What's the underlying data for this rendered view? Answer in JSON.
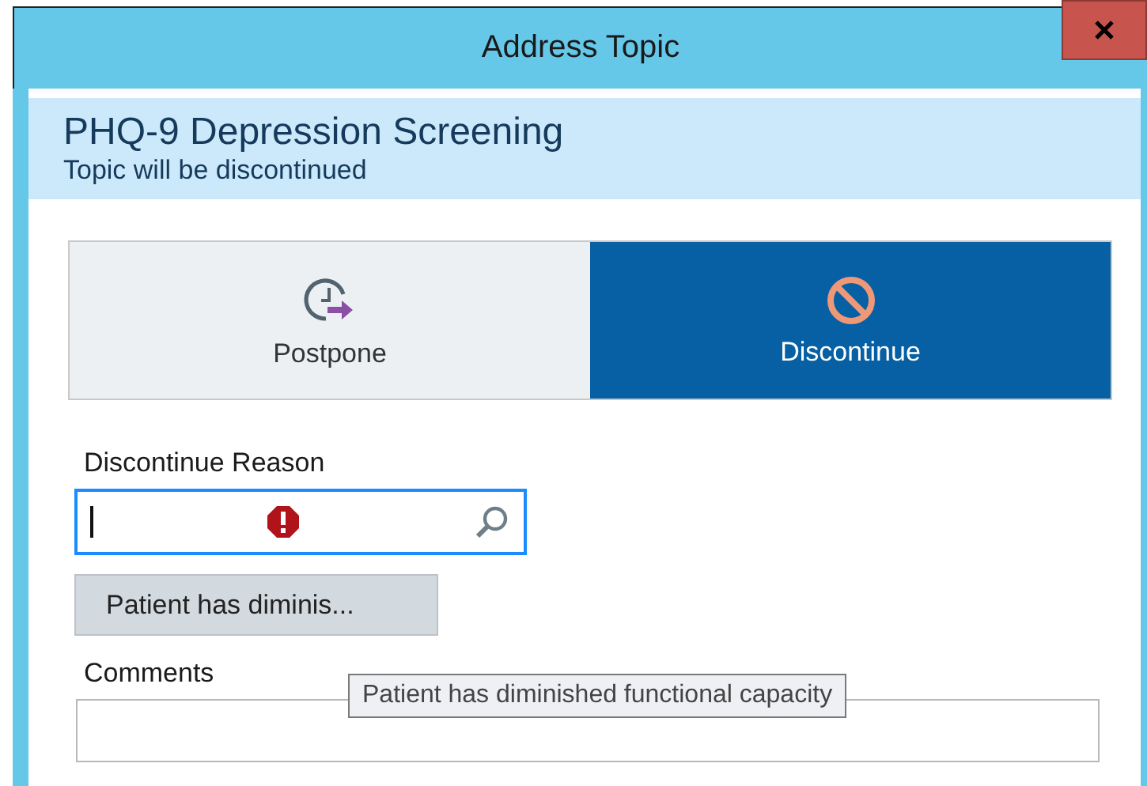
{
  "window": {
    "title": "Address Topic"
  },
  "header": {
    "title": "PHQ-9 Depression Screening",
    "subtitle": "Topic will be discontinued"
  },
  "actions": [
    {
      "kind": "postpone",
      "label": "Postpone",
      "selected": false
    },
    {
      "kind": "discontinue",
      "label": "Discontinue",
      "selected": true
    }
  ],
  "reason": {
    "label": "Discontinue Reason",
    "error": true,
    "chip": "Patient has diminis..."
  },
  "comments": {
    "label": "Comments"
  },
  "tooltip": "Patient has diminished functional capacity"
}
